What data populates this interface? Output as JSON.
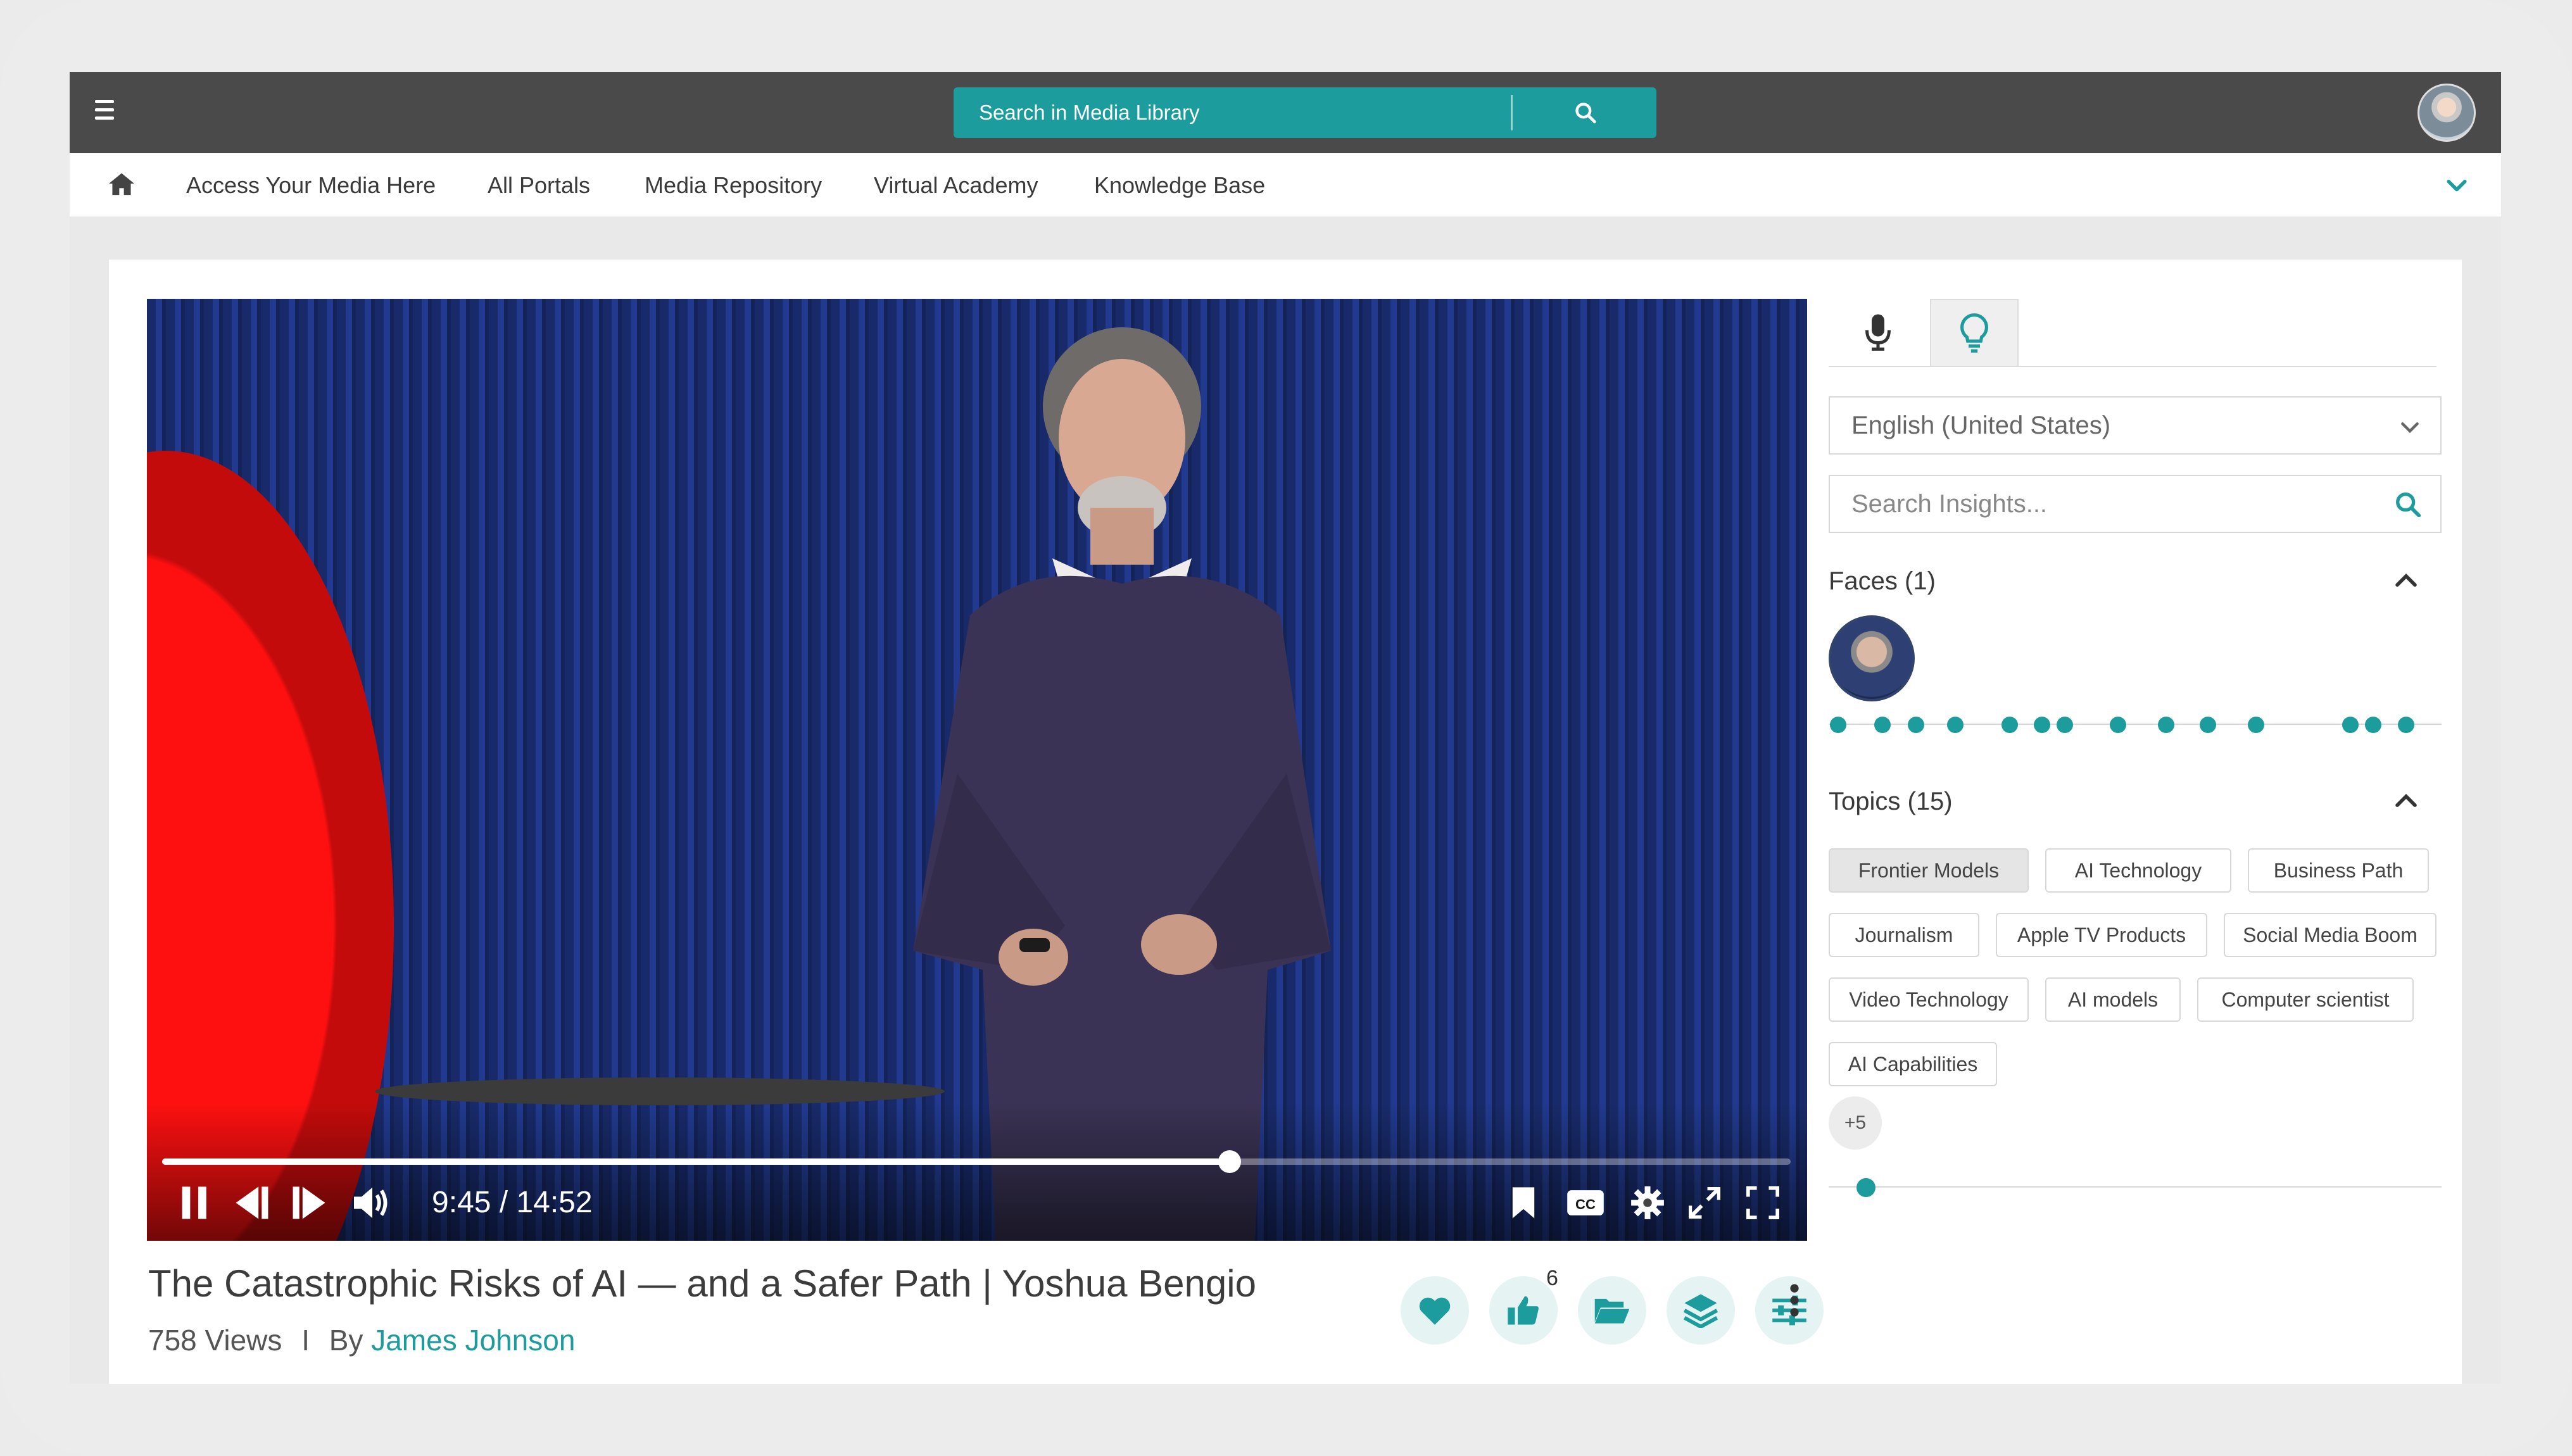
{
  "search": {
    "placeholder": "Search in Media Library"
  },
  "nav": {
    "items": [
      "Access Your Media Here",
      "All Portals",
      "Media Repository",
      "Virtual Academy",
      "Knowledge Base"
    ]
  },
  "video": {
    "time_display": "9:45 / 14:52",
    "progress_fraction": 0.6557,
    "title": "The Catastrophic Risks of AI — and a Safer Path | Yoshua Bengio",
    "views": "758 Views",
    "separator": "I",
    "by_label": "By",
    "author": "James Johnson",
    "like_count": "6"
  },
  "insights": {
    "language": "English (United States)",
    "search_placeholder": "Search Insights...",
    "faces_title": "Faces (1)",
    "face_appearances": [
      0.015,
      0.088,
      0.143,
      0.207,
      0.295,
      0.348,
      0.385,
      0.472,
      0.551,
      0.619,
      0.697,
      0.851,
      0.888,
      0.942
    ],
    "topics_title": "Topics (15)",
    "topics": [
      {
        "label": "Frontier Models",
        "selected": true
      },
      {
        "label": "AI Technology",
        "selected": false
      },
      {
        "label": "Business Path",
        "selected": false
      },
      {
        "label": "Journalism",
        "selected": false
      },
      {
        "label": "Apple TV Products",
        "selected": false
      },
      {
        "label": "Social Media Boom",
        "selected": false
      },
      {
        "label": "Video Technology",
        "selected": false
      },
      {
        "label": "AI models",
        "selected": false
      },
      {
        "label": "Computer scientist",
        "selected": false
      },
      {
        "label": "AI Capabilities",
        "selected": false
      }
    ],
    "more_label": "+5",
    "topic_appearances": [
      0.061
    ]
  },
  "colors": {
    "accent": "#1c9c9c",
    "topbar": "#4a4a4a"
  }
}
